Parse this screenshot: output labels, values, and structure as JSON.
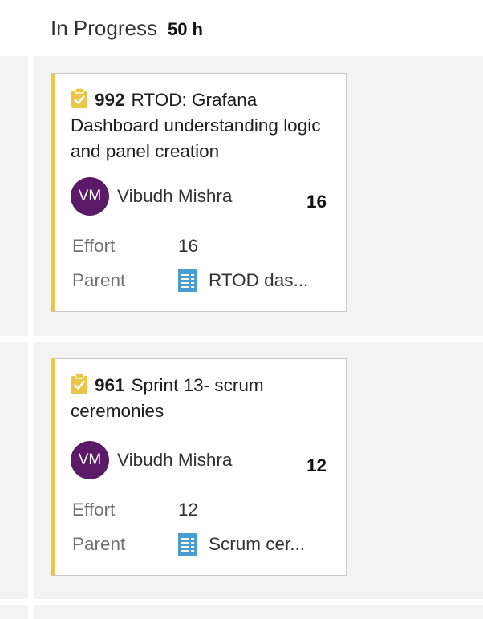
{
  "column": {
    "title": "In Progress",
    "total": "50 h"
  },
  "colors": {
    "accent_bar": "#e9c647",
    "avatar_bg": "#5b1a68",
    "parent_icon": "#4a9dd0",
    "task_icon": "#e9c647"
  },
  "cards": [
    {
      "icon": "task-clipboard-icon",
      "id": "992",
      "title": "RTOD: Grafana Dashboard understanding logic and panel creation",
      "assignee_initials": "VM",
      "assignee_name": "Vibudh Mishra",
      "points": "16",
      "effort_label": "Effort",
      "effort_value": "16",
      "parent_label": "Parent",
      "parent_icon": "document-icon",
      "parent_value": "RTOD das..."
    },
    {
      "icon": "task-clipboard-icon",
      "id": "961",
      "title": "Sprint 13- scrum ceremonies",
      "assignee_initials": "VM",
      "assignee_name": "Vibudh Mishra",
      "points": "12",
      "effort_label": "Effort",
      "effort_value": "12",
      "parent_label": "Parent",
      "parent_icon": "document-icon",
      "parent_value": "Scrum cer..."
    }
  ]
}
